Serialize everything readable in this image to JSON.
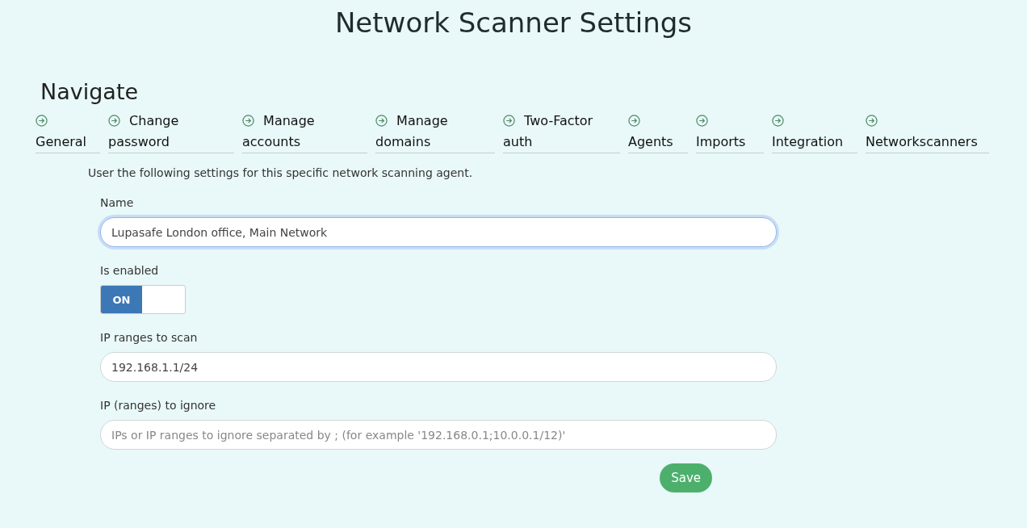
{
  "title": "Network Scanner Settings",
  "nav": {
    "heading": "Navigate",
    "items": [
      {
        "label": "General"
      },
      {
        "label": "Change password"
      },
      {
        "label": "Manage accounts"
      },
      {
        "label": "Manage domains"
      },
      {
        "label": "Two-Factor auth"
      },
      {
        "label": "Agents"
      },
      {
        "label": "Imports"
      },
      {
        "label": "Integration"
      },
      {
        "label": "Networkscanners"
      }
    ]
  },
  "intro": "User the following settings for this specific network scanning agent.",
  "fields": [
    {
      "kind": "text",
      "label": "Name",
      "value": "Lupasafe London office, Main Network",
      "focused": true
    },
    {
      "kind": "switch",
      "label": "Is enabled",
      "on": true,
      "on_text": "ON"
    },
    {
      "kind": "text",
      "label": "IP ranges to scan",
      "value": "192.168.1.1/24",
      "focused": false
    },
    {
      "kind": "text",
      "label": "IP (ranges) to ignore",
      "placeholder": "IPs or IP ranges to ignore separated by ; (for example '192.168.0.1;10.0.0.1/12)'",
      "focused": false
    }
  ],
  "save_button": "Save"
}
